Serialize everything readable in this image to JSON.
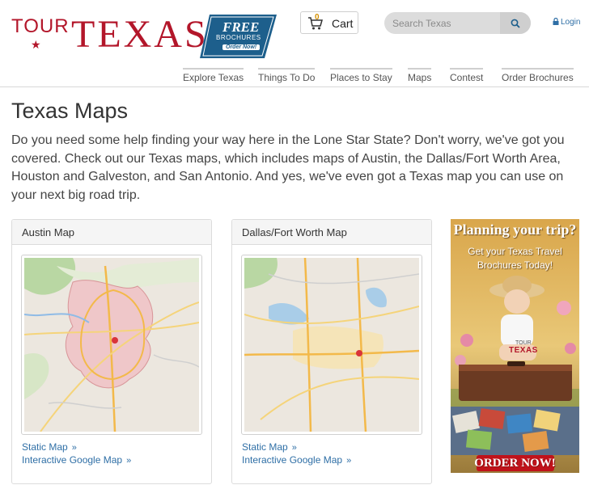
{
  "header": {
    "logo_tour": "TOUR",
    "logo_texas": "TEXAS",
    "badge_free": "FREE",
    "badge_brochures": "BROCHURES",
    "badge_order": "Order Now!",
    "cart_label": "Cart",
    "cart_count": "0",
    "search_placeholder": "Search Texas",
    "login_label": "Login"
  },
  "nav": {
    "items": [
      "Explore Texas",
      "Things To Do",
      "Places to Stay",
      "Maps",
      "Contest",
      "Order Brochures"
    ]
  },
  "main": {
    "title": "Texas Maps",
    "intro": "Do you need some help finding your way here in the Lone Star State? Don't worry, we've got you covered. Check out our Texas maps, which includes maps of Austin, the Dallas/Fort Worth Area, Houston and Galveston, and San Antonio. And yes, we've even got a Texas map you can use on your next big road trip.",
    "cards": [
      {
        "title": "Austin Map",
        "static_link": "Static Map",
        "interactive_link": "Interactive Google Map"
      },
      {
        "title": "Dallas/Fort Worth Map",
        "static_link": "Static Map",
        "interactive_link": "Interactive Google Map"
      }
    ]
  },
  "ad": {
    "line1": "Planning your trip?",
    "line2a": "Get your Texas Travel",
    "line2b": "Brochures Today!",
    "tour": "TOUR",
    "texas": "TEXAS",
    "cta": "ORDER NOW!"
  },
  "colors": {
    "brand_red": "#b3162a",
    "link_blue": "#2f6fa6",
    "badge_blue": "#1d5f8c"
  },
  "icons": {
    "cart": "cart-icon",
    "search": "search-icon",
    "login": "lock-icon",
    "star": "star-icon",
    "chevron": "chevron-right-icon"
  }
}
